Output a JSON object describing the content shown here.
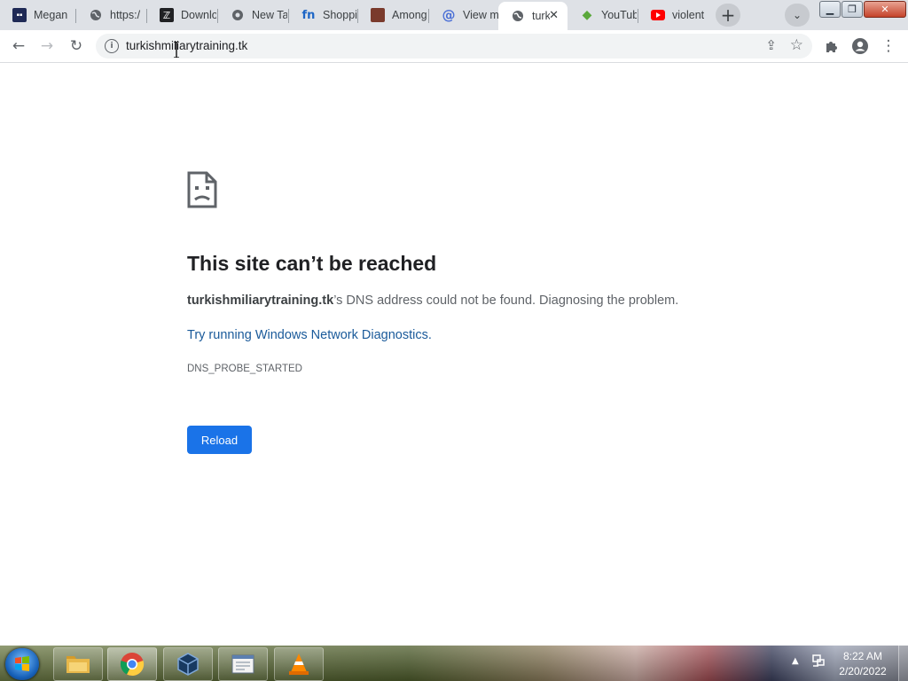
{
  "tabs": [
    {
      "title": "Megan",
      "favicon": "megan-site-icon"
    },
    {
      "title": "https:/",
      "favicon": "globe-icon"
    },
    {
      "title": "Downlo",
      "favicon": "download-site-icon"
    },
    {
      "title": "New Ta",
      "favicon": "chrome-icon"
    },
    {
      "title": "Shoppi",
      "favicon": "fn-icon"
    },
    {
      "title": "Among",
      "favicon": "among-site-icon"
    },
    {
      "title": "View m",
      "favicon": "at-icon"
    },
    {
      "title": "turk",
      "favicon": "globe-icon"
    },
    {
      "title": "YouTub",
      "favicon": "gem-icon"
    },
    {
      "title": "violent",
      "favicon": "youtube-icon"
    }
  ],
  "address_bar": {
    "url": "turkishmiliarytraining.tk"
  },
  "error_page": {
    "title": "This site can’t be reached",
    "domain": "turkishmiliarytraining.tk",
    "description": "’s DNS address could not be found. Diagnosing the problem.",
    "link_prefix": "Try running ",
    "link_text": "Windows Network Diagnostics",
    "link_suffix": ".",
    "error_code": "DNS_PROBE_STARTED",
    "reload_label": "Reload"
  },
  "colors": {
    "accent": "#1a73e8",
    "link": "#1a5a9a"
  },
  "taskbar": {
    "apps": [
      "windows-explorer",
      "google-chrome",
      "virtualbox",
      "notepad-document",
      "vlc-media-player"
    ],
    "clock": {
      "time": "8:22 AM",
      "date": "2/20/2022"
    }
  }
}
